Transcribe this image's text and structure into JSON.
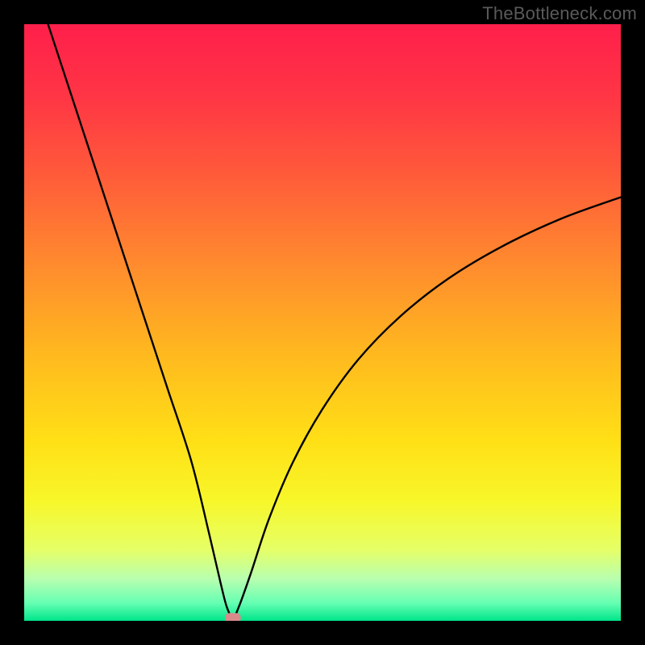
{
  "watermark": "TheBottleneck.com",
  "chart_data": {
    "type": "line",
    "title": "",
    "xlabel": "",
    "ylabel": "",
    "xlim": [
      0,
      100
    ],
    "ylim": [
      0,
      100
    ],
    "grid": false,
    "legend": false,
    "background": {
      "type": "vertical-gradient",
      "stops": [
        {
          "pos": 0.0,
          "color": "#ff1f4b"
        },
        {
          "pos": 0.12,
          "color": "#ff3545"
        },
        {
          "pos": 0.25,
          "color": "#ff5a3a"
        },
        {
          "pos": 0.4,
          "color": "#ff8a2e"
        },
        {
          "pos": 0.55,
          "color": "#ffb81f"
        },
        {
          "pos": 0.7,
          "color": "#ffe016"
        },
        {
          "pos": 0.8,
          "color": "#f7f72a"
        },
        {
          "pos": 0.88,
          "color": "#e6ff66"
        },
        {
          "pos": 0.93,
          "color": "#b8ffb0"
        },
        {
          "pos": 0.97,
          "color": "#66ffb3"
        },
        {
          "pos": 1.0,
          "color": "#00e58a"
        }
      ]
    },
    "curve": {
      "description": "V-shaped bottleneck curve; left branch nearly straight descending to minimum, right branch concave ascending",
      "points": [
        {
          "x": 4.0,
          "y": 100.0
        },
        {
          "x": 8.0,
          "y": 87.8
        },
        {
          "x": 12.0,
          "y": 75.6
        },
        {
          "x": 16.0,
          "y": 63.4
        },
        {
          "x": 20.0,
          "y": 51.2
        },
        {
          "x": 24.0,
          "y": 39.0
        },
        {
          "x": 28.0,
          "y": 26.8
        },
        {
          "x": 31.0,
          "y": 14.6
        },
        {
          "x": 33.0,
          "y": 6.0
        },
        {
          "x": 34.0,
          "y": 2.2
        },
        {
          "x": 35.0,
          "y": 0.5
        },
        {
          "x": 36.0,
          "y": 2.4
        },
        {
          "x": 38.0,
          "y": 8.0
        },
        {
          "x": 41.0,
          "y": 17.0
        },
        {
          "x": 45.0,
          "y": 26.5
        },
        {
          "x": 50.0,
          "y": 35.5
        },
        {
          "x": 56.0,
          "y": 43.8
        },
        {
          "x": 63.0,
          "y": 51.0
        },
        {
          "x": 71.0,
          "y": 57.3
        },
        {
          "x": 80.0,
          "y": 62.7
        },
        {
          "x": 90.0,
          "y": 67.4
        },
        {
          "x": 100.0,
          "y": 71.0
        }
      ]
    },
    "marker": {
      "x": 35.0,
      "y": 0.5,
      "shape": "rounded-rect",
      "color": "#d98b8b",
      "width": 2.6,
      "height": 1.6
    }
  }
}
